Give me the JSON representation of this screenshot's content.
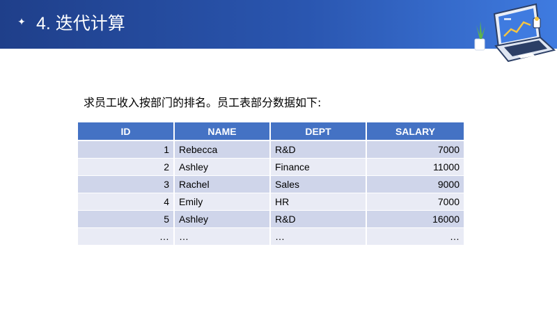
{
  "header": {
    "bullet": "✦",
    "title": "4. 迭代计算"
  },
  "intro": "求员工收入按部门的排名。员工表部分数据如下:",
  "table": {
    "columns": [
      "ID",
      "NAME",
      "DEPT",
      "SALARY"
    ],
    "rows": [
      {
        "id": "1",
        "name": "Rebecca",
        "dept": "R&D",
        "salary": "7000"
      },
      {
        "id": "2",
        "name": "Ashley",
        "dept": "Finance",
        "salary": "11000"
      },
      {
        "id": "3",
        "name": "Rachel",
        "dept": "Sales",
        "salary": "9000"
      },
      {
        "id": "4",
        "name": "Emily",
        "dept": "HR",
        "salary": "7000"
      },
      {
        "id": "5",
        "name": "Ashley",
        "dept": "R&D",
        "salary": "16000"
      },
      {
        "id": "…",
        "name": "…",
        "dept": "…",
        "salary": "…"
      }
    ]
  },
  "colors": {
    "header_band_start": "#1f3f8a",
    "header_band_end": "#3f7be0",
    "table_header": "#4472c4",
    "row_dark": "#cfd5ea",
    "row_light": "#e9ebf5"
  }
}
